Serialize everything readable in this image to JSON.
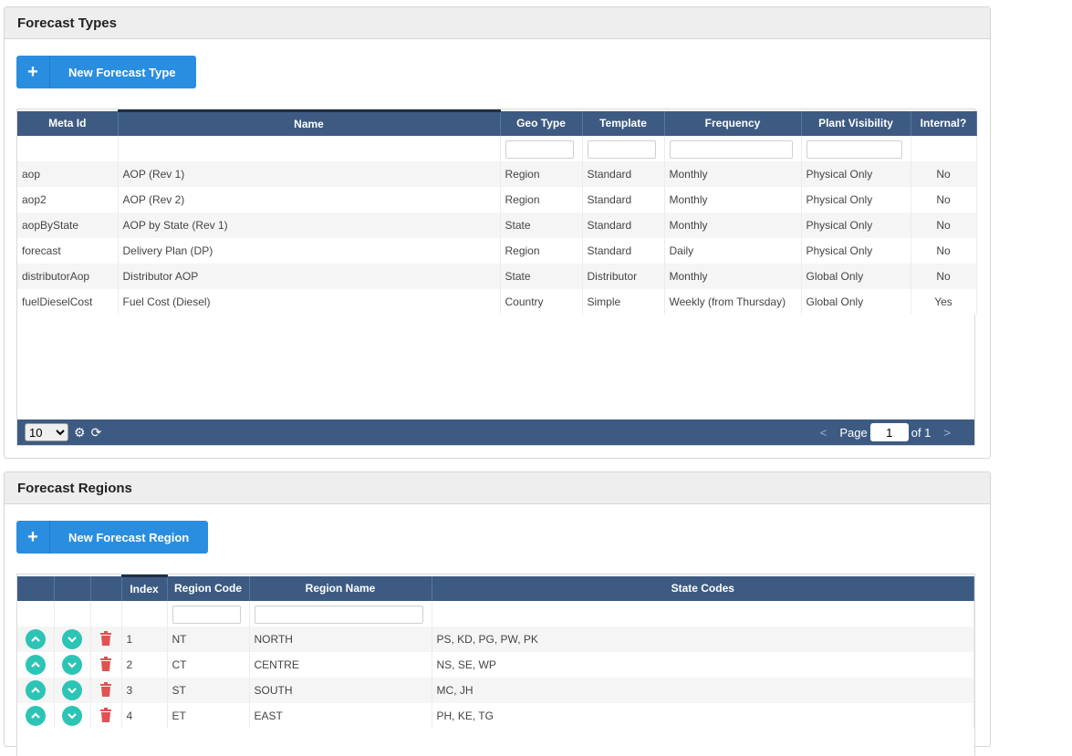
{
  "types_panel": {
    "title": "Forecast Types",
    "add_button": "New Forecast Type",
    "columns": [
      "Meta Id",
      "Name",
      "Geo Type",
      "Template",
      "Frequency",
      "Plant Visibility",
      "Internal?"
    ],
    "rows": [
      [
        "aop",
        "AOP (Rev 1)",
        "Region",
        "Standard",
        "Monthly",
        "Physical Only",
        "No"
      ],
      [
        "aop2",
        "AOP (Rev 2)",
        "Region",
        "Standard",
        "Monthly",
        "Physical Only",
        "No"
      ],
      [
        "aopByState",
        "AOP by State (Rev 1)",
        "State",
        "Standard",
        "Monthly",
        "Physical Only",
        "No"
      ],
      [
        "forecast",
        "Delivery Plan (DP)",
        "Region",
        "Standard",
        "Daily",
        "Physical Only",
        "No"
      ],
      [
        "distributorAop",
        "Distributor AOP",
        "State",
        "Distributor",
        "Monthly",
        "Global Only",
        "No"
      ],
      [
        "fuelDieselCost",
        "Fuel Cost (Diesel)",
        "Country",
        "Simple",
        "Weekly (from Thursday)",
        "Global Only",
        "Yes"
      ]
    ],
    "pager": {
      "page_size": "10",
      "page_label": "Page",
      "page_value": "1",
      "of_label": "of 1",
      "prev": "<",
      "next": ">"
    }
  },
  "regions_panel": {
    "title": "Forecast Regions",
    "add_button": "New Forecast Region",
    "columns": [
      "",
      "",
      "",
      "Index",
      "Region Code",
      "Region Name",
      "State Codes"
    ],
    "rows": [
      [
        "1",
        "NT",
        "NORTH",
        "PS, KD, PG, PW, PK"
      ],
      [
        "2",
        "CT",
        "CENTRE",
        "NS, SE, WP"
      ],
      [
        "3",
        "ST",
        "SOUTH",
        "MC, JH"
      ],
      [
        "4",
        "ET",
        "EAST",
        "PH, KE, TG"
      ]
    ]
  },
  "colors": {
    "header_bg": "#3d5b82",
    "button_bg": "#2a8ee0",
    "round_button": "#2cc4b5",
    "trash": "#e05252"
  },
  "icons": [
    "plus-icon",
    "gear-icon",
    "refresh-icon",
    "chevron-up-icon",
    "chevron-down-icon",
    "trash-icon"
  ]
}
